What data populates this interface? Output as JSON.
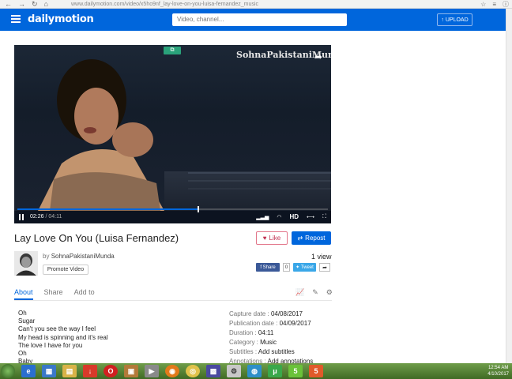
{
  "browser": {
    "url": "www.dailymotion.com/video/x5ho9nf_lay-love-on-you-luisa-fernandez_music"
  },
  "header": {
    "logo": "dailymotion",
    "search_placeholder": "Video, channel...",
    "upload_label": "UPLOAD",
    "brand_color": "#0066dc"
  },
  "player": {
    "watermark": "SohnaPakistaniMunda",
    "current_time": "02:26",
    "time_separator": "/",
    "duration": "04:11",
    "progress_fraction": 0.58,
    "quality_label": "HD"
  },
  "video": {
    "title": "Lay Love On You (Luisa Fernandez)",
    "like_label": "Like",
    "repost_label": "Repost",
    "by_prefix": "by",
    "channel": "SohnaPakistaniMunda",
    "promote_label": "Promote Video",
    "views": "1 view",
    "fb_share": "Share",
    "fb_count": "0",
    "tweet_label": "Tweet"
  },
  "tabs": [
    {
      "label": "About",
      "active": true
    },
    {
      "label": "Share",
      "active": false
    },
    {
      "label": "Add to",
      "active": false
    }
  ],
  "lyrics": [
    "Oh",
    "Sugar",
    "Can't you see the way I feel",
    "My head is spinning and it's real",
    "The love I have for you",
    "Oh",
    "Baby"
  ],
  "meta": {
    "capture_label": "Capture date :",
    "capture_value": "04/08/2017",
    "publication_label": "Publication date :",
    "publication_value": "04/09/2017",
    "duration_label": "Duration :",
    "duration_value": "04:11",
    "category_label": "Category :",
    "category_value": "Music",
    "subtitles_label": "Subtitles :",
    "subtitles_value": "Add subtitles",
    "annotations_label": "Annotations :",
    "annotations_value": "Add annotations"
  },
  "taskbar": {
    "time": "12:54 AM",
    "date": "4/10/2017"
  }
}
